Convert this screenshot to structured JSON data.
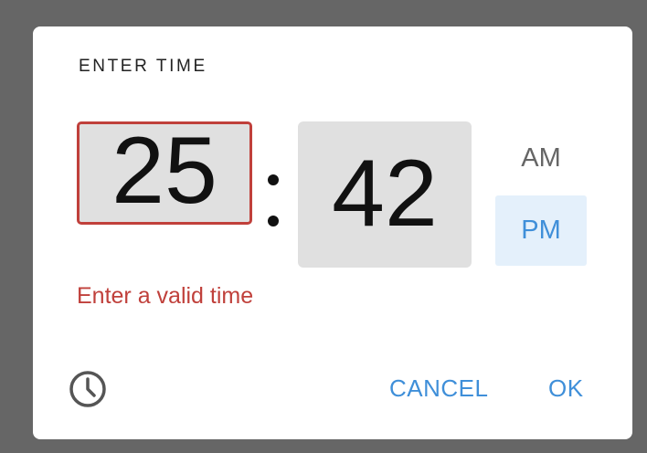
{
  "dialog": {
    "title": "ENTER TIME",
    "hour": "25",
    "minute": "42",
    "separator": ":",
    "am_label": "AM",
    "pm_label": "PM",
    "selected_period": "PM",
    "error": "Enter a valid time",
    "cancel_label": "CANCEL",
    "ok_label": "OK",
    "mode_toggle_icon": "clock-icon"
  },
  "colors": {
    "accent": "#3f8fd9",
    "error": "#c0403b",
    "field_bg": "#e0e0e0",
    "selected_bg": "#e4f0fb",
    "scrim": "#666666"
  }
}
